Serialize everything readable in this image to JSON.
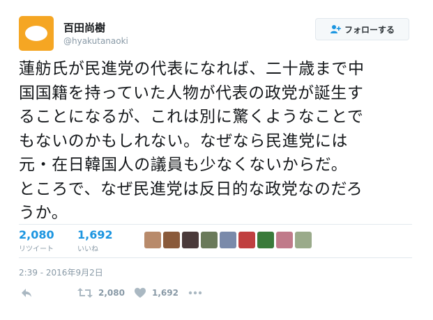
{
  "user": {
    "name": "百田尚樹",
    "handle": "@hyakutanaoki",
    "avatar_color": "#f5a623"
  },
  "follow_button": {
    "label": "フォローする",
    "icon": "user-plus-icon"
  },
  "tweet": {
    "lines": [
      "蓮舫氏が民進党の代表になれば、二十歳まで中",
      "国国籍を持っていた人物が代表の政党が誕生す",
      "ることになるが、これは別に驚くようなことで",
      "もないのかもしれない。なぜなら民進党には",
      "元・在日韓国人の議員も少なくないからだ。",
      "ところで、なぜ民進党は反日的な政党なのだろ",
      "うか。"
    ]
  },
  "stats": {
    "retweets": {
      "count": "2,080",
      "label": "リツイート"
    },
    "likes": {
      "count": "1,692",
      "label": "いいね"
    }
  },
  "liker_avatar_colors": [
    "#b88a6a",
    "#8a5a3a",
    "#4a3a3a",
    "#6a7a5a",
    "#7a8aaa",
    "#c04040",
    "#3a7a3a",
    "#c07a8a",
    "#9aaa8a"
  ],
  "timestamp": "2:39 - 2016年9月2日",
  "actions": {
    "retweet_count": "2,080",
    "like_count": "1,692"
  },
  "colors": {
    "accent": "#1b95e0",
    "muted": "#8899a6",
    "text": "#14171a",
    "icon_gray": "#aab8c2"
  }
}
